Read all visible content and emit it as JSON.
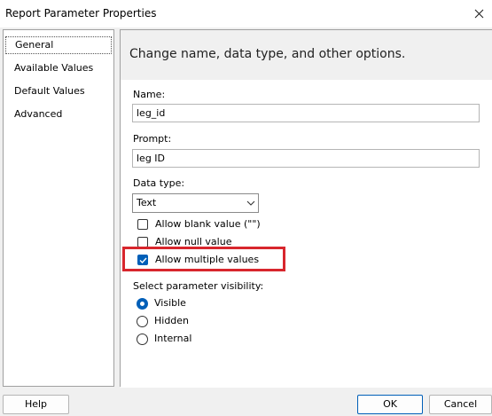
{
  "window": {
    "title": "Report Parameter Properties"
  },
  "nav": {
    "items": [
      {
        "label": "General"
      },
      {
        "label": "Available Values"
      },
      {
        "label": "Default Values"
      },
      {
        "label": "Advanced"
      }
    ]
  },
  "header": {
    "text": "Change name, data type, and other options."
  },
  "form": {
    "name_label": "Name:",
    "name_value": "leg_id",
    "prompt_label": "Prompt:",
    "prompt_value": "leg ID",
    "datatype_label": "Data type:",
    "datatype_value": "Text",
    "checkboxes": [
      {
        "label": "Allow blank value (\"\")",
        "checked": false
      },
      {
        "label": "Allow null value",
        "checked": false
      },
      {
        "label": "Allow multiple values",
        "checked": true
      }
    ],
    "visibility_label": "Select parameter visibility:",
    "visibility_options": [
      {
        "label": "Visible",
        "selected": true
      },
      {
        "label": "Hidden",
        "selected": false
      },
      {
        "label": "Internal",
        "selected": false
      }
    ]
  },
  "buttons": {
    "help": "Help",
    "ok": "OK",
    "cancel": "Cancel"
  },
  "colors": {
    "accent": "#005fb8",
    "highlight": "#d8262d"
  }
}
